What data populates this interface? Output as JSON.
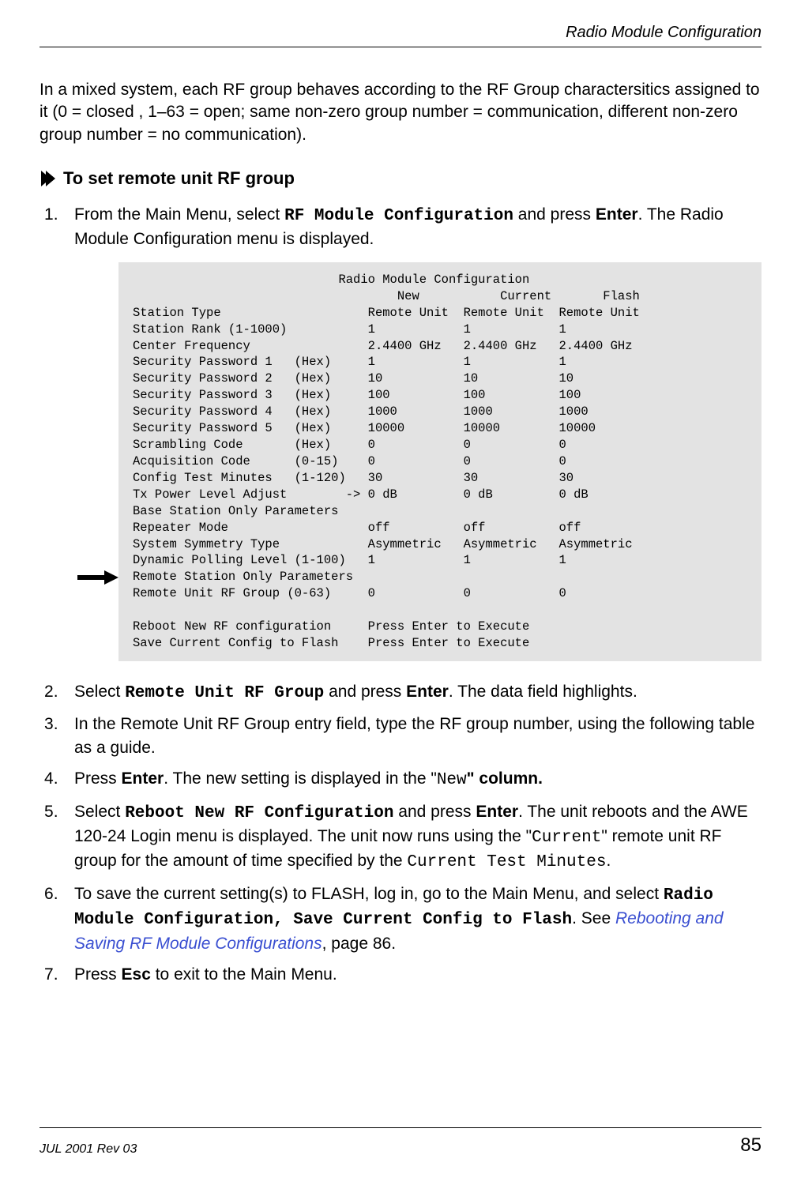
{
  "running_head": "Radio Module Configuration",
  "intro_paragraph": "In a mixed system, each RF group behaves according to the RF Group charactersitics assigned to it (0 = closed ,  1–63 = open; same non-zero group number = communication, different non-zero group number = no communication).",
  "proc_title": "To set remote unit RF group",
  "steps": {
    "s1": {
      "pre1": "From the Main Menu, select ",
      "cmd1": "RF Module Configuration",
      "mid1": " and press ",
      "key1": "Enter",
      "post1": ". The Radio Module Configuration menu is displayed."
    },
    "s2": {
      "pre": "Select ",
      "cmd": "Remote Unit RF Group",
      "mid": " and press ",
      "key": "Enter",
      "post": ". The data field highlights."
    },
    "s3": {
      "text": "In the Remote Unit RF Group entry field, type the RF group number, using the following table as a guide."
    },
    "s4": {
      "pre": "Press ",
      "key": "Enter",
      "mid": ". The new setting is displayed in the \"",
      "code": "New",
      "post": "\" column."
    },
    "s5": {
      "pre": "Select ",
      "cmd": "Reboot New RF Configuration",
      "mid1": " and press ",
      "key": "Enter",
      "mid2": ". The unit reboots and the AWE 120-24 Login menu is displayed. The unit now runs using the \"",
      "code1": "Current",
      "mid3": "\" remote unit RF group for the amount of time specified by the ",
      "code2": "Current Test Minutes",
      "post": "."
    },
    "s6": {
      "pre": "To save the current setting(s) to FLASH, log in, go to the Main Menu, and select ",
      "cmd": "Radio Module Configuration, Save Current Config to Flash",
      "mid": ". See ",
      "link": "Rebooting and Saving RF Module Configurations",
      "post": ", page 86."
    },
    "s7": {
      "pre": "Press ",
      "key": "Esc",
      "post": " to exit to the Main Menu."
    }
  },
  "terminal": {
    "title": "Radio Module Configuration",
    "col_headers": {
      "new": "New",
      "current": "Current",
      "flash": "Flash"
    },
    "rows": [
      {
        "label": "Station Type",
        "suffix": "",
        "new": "Remote Unit",
        "cur": "Remote Unit",
        "flash": "Remote Unit"
      },
      {
        "label": "Station Rank (1-1000)",
        "suffix": "",
        "new": "1",
        "cur": "1",
        "flash": "1"
      },
      {
        "label": "Center Frequency",
        "suffix": "",
        "new": "2.4400 GHz",
        "cur": "2.4400 GHz",
        "flash": "2.4400 GHz"
      },
      {
        "label": "Security Password 1",
        "suffix": "(Hex)",
        "new": "1",
        "cur": "1",
        "flash": "1"
      },
      {
        "label": "Security Password 2",
        "suffix": "(Hex)",
        "new": "10",
        "cur": "10",
        "flash": "10"
      },
      {
        "label": "Security Password 3",
        "suffix": "(Hex)",
        "new": "100",
        "cur": "100",
        "flash": "100"
      },
      {
        "label": "Security Password 4",
        "suffix": "(Hex)",
        "new": "1000",
        "cur": "1000",
        "flash": "1000"
      },
      {
        "label": "Security Password 5",
        "suffix": "(Hex)",
        "new": "10000",
        "cur": "10000",
        "flash": "10000"
      },
      {
        "label": "Scrambling Code",
        "suffix": "(Hex)",
        "new": "0",
        "cur": "0",
        "flash": "0"
      },
      {
        "label": "Acquisition Code",
        "suffix": "(0-15)",
        "new": "0",
        "cur": "0",
        "flash": "0"
      },
      {
        "label": "Config Test Minutes",
        "suffix": "(1-120)",
        "new": "30",
        "cur": "30",
        "flash": "30"
      },
      {
        "label": "Tx Power Level Adjust",
        "suffix": "->",
        "new": "0 dB",
        "cur": "0 dB",
        "flash": "0 dB"
      }
    ],
    "base_header": "Base Station Only Parameters",
    "base_rows": [
      {
        "label": "Repeater Mode",
        "new": "off",
        "cur": "off",
        "flash": "off"
      },
      {
        "label": "System Symmetry Type",
        "new": "Asymmetric",
        "cur": "Asymmetric",
        "flash": "Asymmetric"
      },
      {
        "label": "Dynamic Polling Level (1-100)",
        "new": "1",
        "cur": "1",
        "flash": "1"
      }
    ],
    "remote_header": "Remote Station Only Parameters",
    "remote_row": {
      "label": "Remote Unit RF Group (0-63)",
      "new": "0",
      "cur": "0",
      "flash": "0"
    },
    "action_rows": [
      {
        "label": "Reboot New RF configuration",
        "text": "Press Enter to Execute"
      },
      {
        "label": "Save Current Config to Flash",
        "text": "Press Enter to Execute"
      }
    ]
  },
  "footer": {
    "left": "JUL 2001 Rev 03",
    "right": "85"
  }
}
